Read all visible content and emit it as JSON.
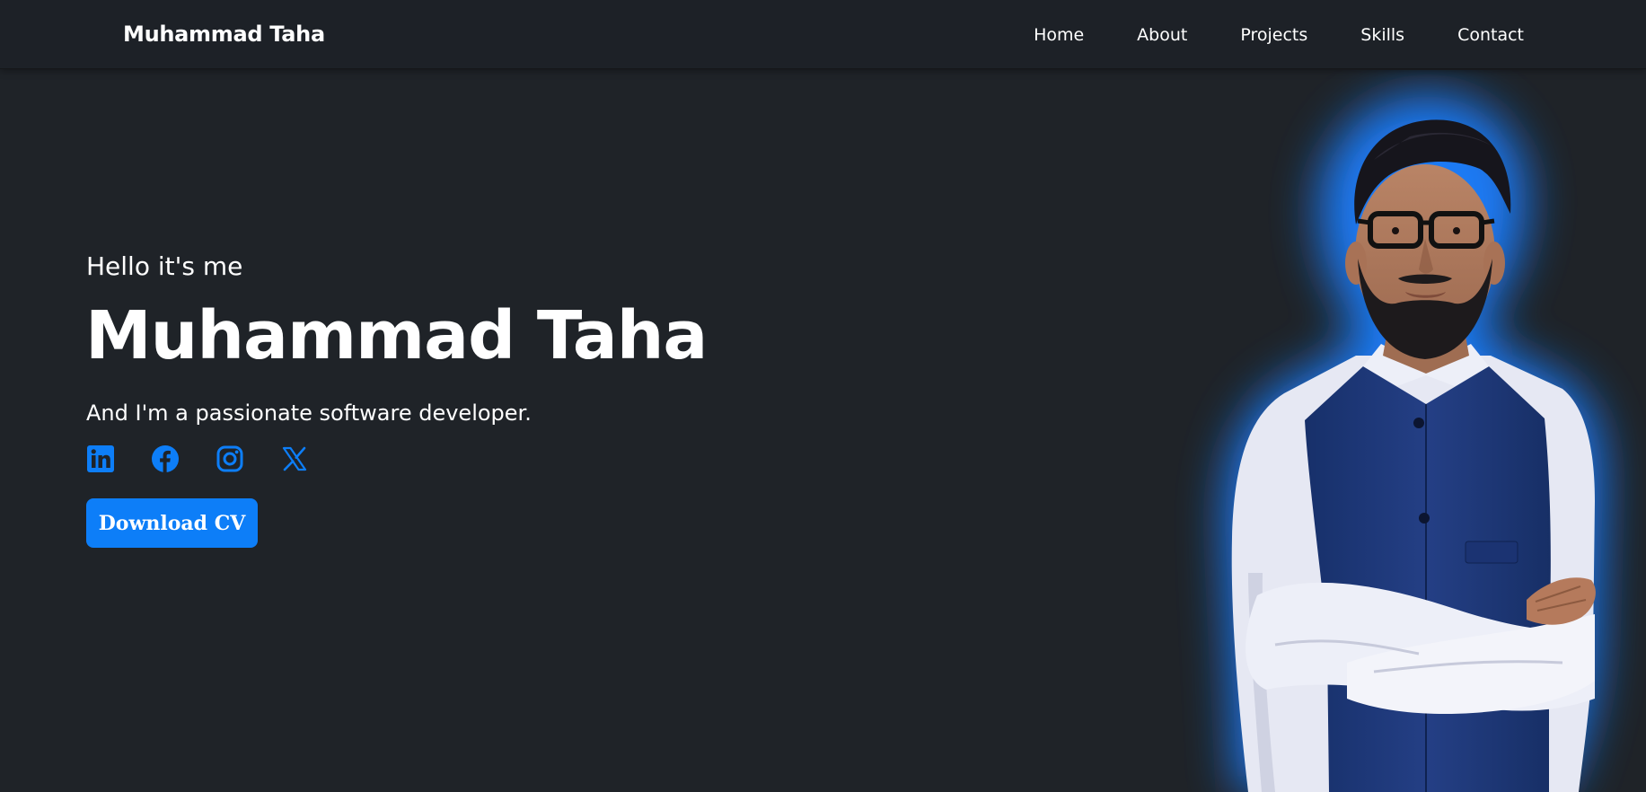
{
  "navbar": {
    "brand": "Muhammad Taha",
    "links": [
      "Home",
      "About",
      "Projects",
      "Skills",
      "Contact"
    ]
  },
  "hero": {
    "greeting": "Hello it's me",
    "name": "Muhammad Taha",
    "tagline": "And I'm a passionate software developer.",
    "cv_button": "Download CV",
    "socials": [
      "linkedin-icon",
      "facebook-icon",
      "instagram-icon",
      "x-icon"
    ]
  },
  "colors": {
    "background": "#1f2328",
    "navbar": "#1d2127",
    "accent": "#0d7ef8",
    "glow": "#1a7fff",
    "vest": "#1f3a7a",
    "shirt": "#e9ebf5"
  }
}
